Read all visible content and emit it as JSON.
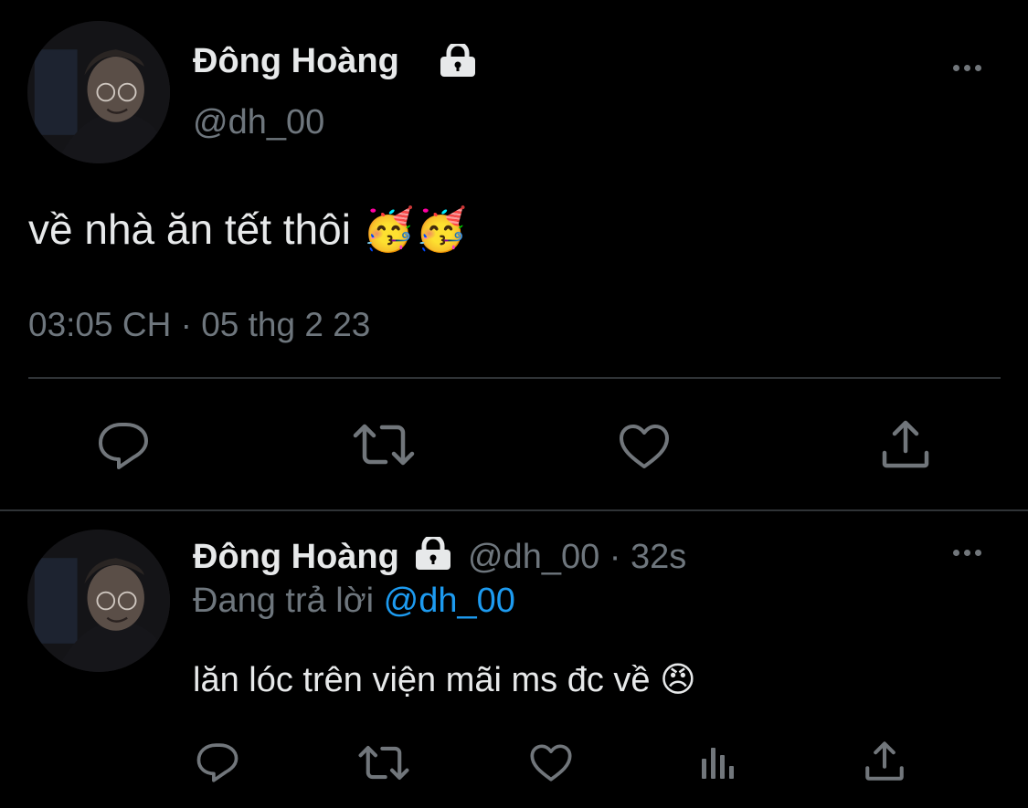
{
  "main_tweet": {
    "author_name": "Đông Hoàng",
    "author_handle": "@dh_00",
    "text": "về nhà ăn tết thôi",
    "emojis": "🥳🥳",
    "timestamp": "03:05 CH · 05 thg 2 23"
  },
  "reply_tweet": {
    "author_name": "Đông Hoàng",
    "author_handle": "@dh_00",
    "time_ago": "· 32s",
    "replying_prefix": "Đang trả lời",
    "replying_to": "@dh_00",
    "text": "lăn lóc trên viện mãi ms đc về",
    "emoji": "😠"
  },
  "icons": {
    "reply": "reply-icon",
    "retweet": "retweet-icon",
    "like": "heart-icon",
    "share": "share-icon",
    "analytics": "analytics-icon",
    "lock": "lock-icon",
    "more": "more-icon"
  },
  "colors": {
    "background": "#000000",
    "text": "#e7e9ea",
    "muted": "#6e767d",
    "link": "#1d9bf0",
    "divider": "#2f3336"
  }
}
